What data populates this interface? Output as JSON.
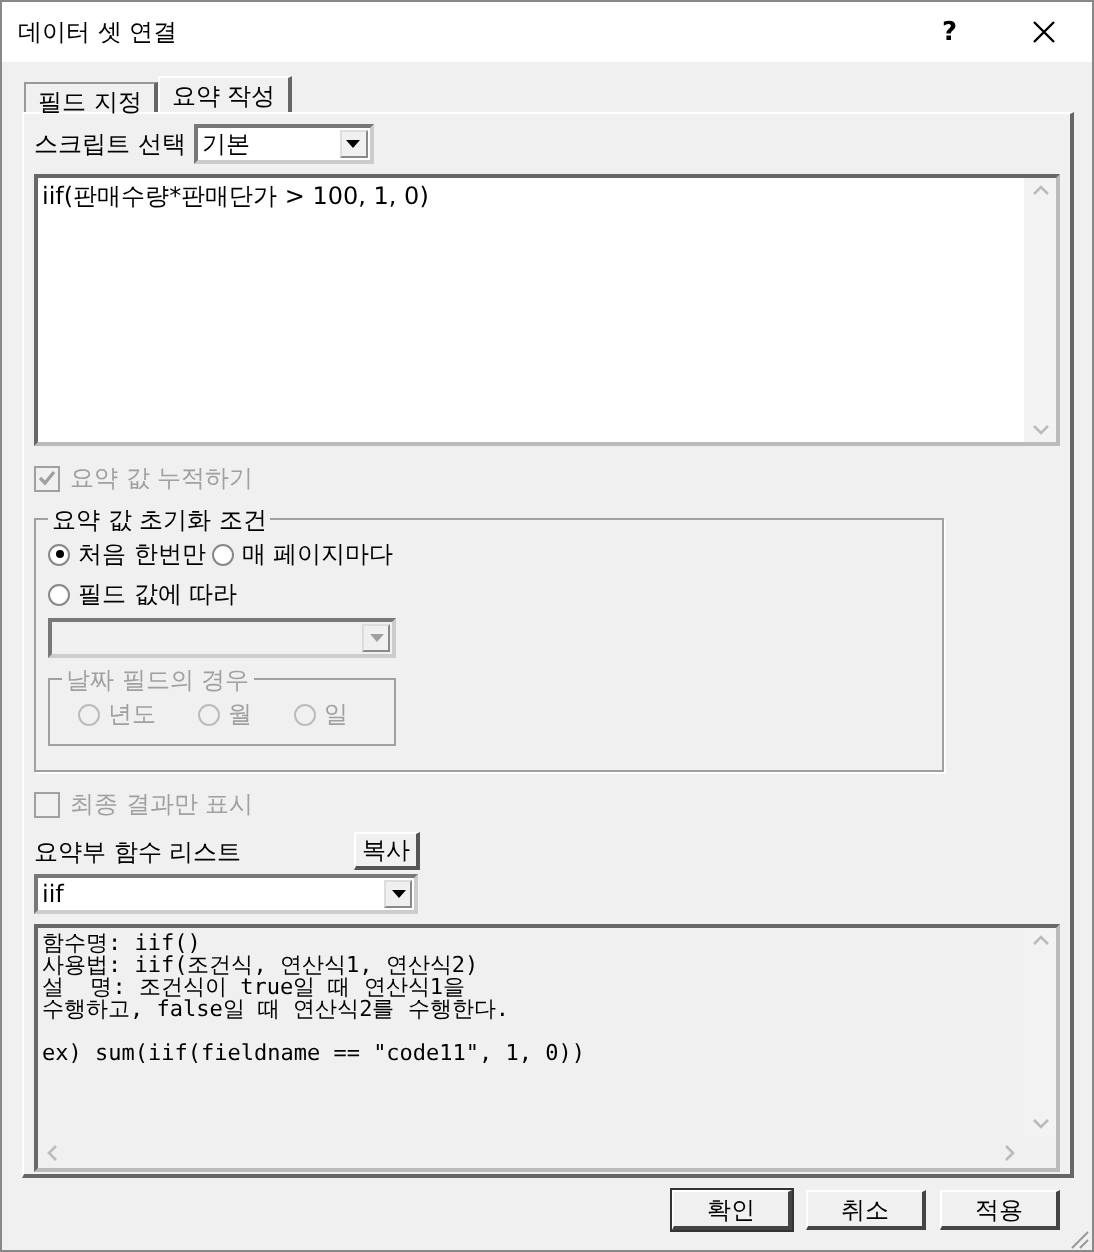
{
  "window": {
    "title": "데이터 셋 연결",
    "help": "?"
  },
  "tabs": [
    {
      "label": "필드 지정",
      "selected": false
    },
    {
      "label": "요약 작성",
      "selected": true
    }
  ],
  "script_select": {
    "label": "스크립트 선택",
    "value": "기본"
  },
  "script_editor": {
    "lines": [
      "iif(판매수량*판매단가 > 100, 1, 0)"
    ]
  },
  "accumulate": {
    "label": "요약 값 누적하기",
    "checked": true,
    "disabled": true
  },
  "reset_group": {
    "title": "요약 값 초기화 조건",
    "options": [
      {
        "label": "처음 한번만",
        "selected": true
      },
      {
        "label": "매 페이지마다",
        "selected": false
      },
      {
        "label": "필드 값에 따라",
        "selected": false
      }
    ],
    "field_dropdown": {
      "disabled": true
    },
    "date_group": {
      "title": "날짜 필드의 경우",
      "disabled": true,
      "options": [
        {
          "label": "년도",
          "selected": false
        },
        {
          "label": "월",
          "selected": false
        },
        {
          "label": "일",
          "selected": false
        }
      ]
    }
  },
  "final_only": {
    "label": "최종 결과만 표시",
    "checked": false,
    "disabled": true
  },
  "function_list": {
    "label": "요약부 함수 리스트",
    "copy_button": "복사",
    "value": "iif"
  },
  "description": {
    "blocks": [
      {
        "lines": [
          "함수명: iif()",
          "사용법: iif(조건식, 연산식1, 연산식2)",
          "설  명: 조건식이 true일 때 연산식1을",
          "수행하고, false일 때 연산식2를 수행한다."
        ]
      },
      {
        "lines": [
          "ex) sum(iif(fieldname == \"code11\", 1, 0))"
        ]
      }
    ]
  },
  "buttons": [
    "확인",
    "취소",
    "적용"
  ]
}
